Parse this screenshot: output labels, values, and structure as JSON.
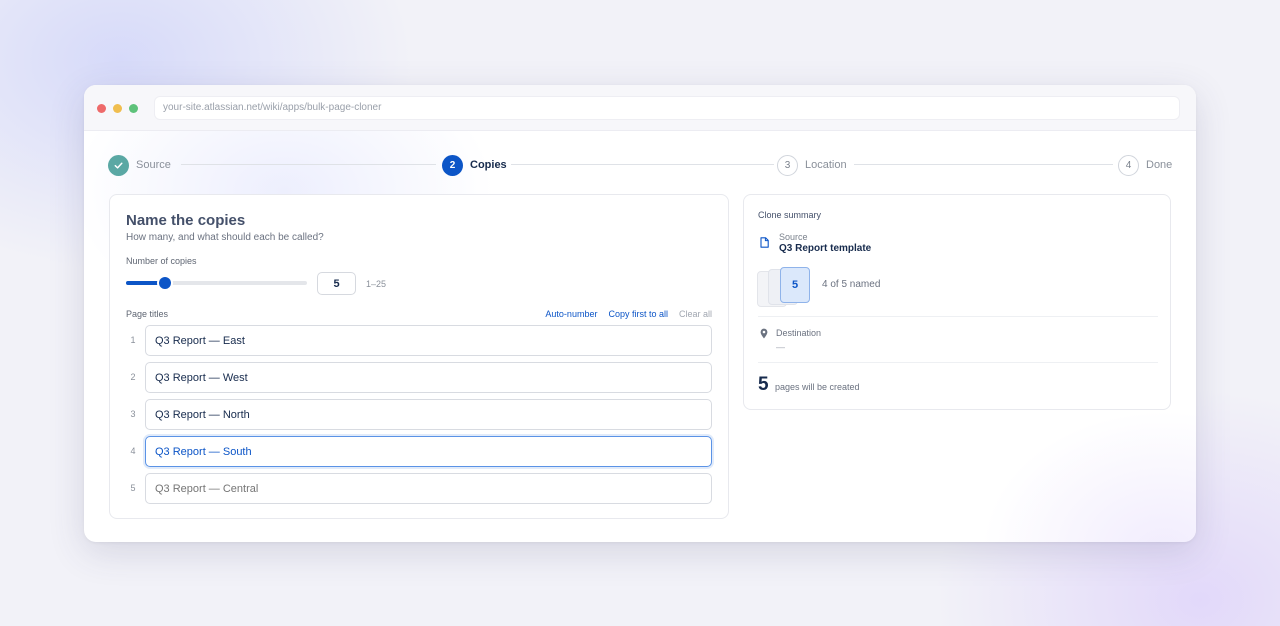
{
  "browser": {
    "url": "your-site.atlassian.net/wiki/apps/bulk-page-cloner"
  },
  "stepper": {
    "steps": [
      {
        "label": "Source",
        "state": "done",
        "number": "1"
      },
      {
        "label": "Copies",
        "state": "active",
        "number": "2"
      },
      {
        "label": "Location",
        "state": "todo",
        "number": "3"
      },
      {
        "label": "Done",
        "state": "todo",
        "number": "4"
      }
    ],
    "check_icon": "check-icon"
  },
  "copies_panel": {
    "title": "Name the copies",
    "subtitle": "How many, and what should each be called?",
    "count_label": "Number of copies",
    "count_value": "5",
    "count_min": 1,
    "count_max": 25,
    "range_hint": "1–25",
    "titles_label": "Page titles",
    "actions": {
      "auto_number": "Auto-number",
      "copy_first": "Copy first to all",
      "clear_all": "Clear all"
    },
    "rows": [
      {
        "index": "1",
        "value": "Q3 Report — East",
        "placeholder": ""
      },
      {
        "index": "2",
        "value": "Q3 Report — West",
        "placeholder": ""
      },
      {
        "index": "3",
        "value": "Q3 Report — North",
        "placeholder": ""
      },
      {
        "index": "4",
        "value": "Q3 Report — South",
        "placeholder": ""
      },
      {
        "index": "5",
        "value": "",
        "placeholder": "Q3 Report — Central"
      }
    ]
  },
  "summary": {
    "title": "Clone summary",
    "source_label": "Source",
    "source_name": "Q3 Report template",
    "stack_count": "5",
    "named_text": "4 of 5 named",
    "destination_label": "Destination",
    "destination_value": "—",
    "pages_count": "5",
    "pages_text": "pages will be created"
  },
  "colors": {
    "accent": "#0c55c7",
    "done": "#5aa8a4"
  }
}
